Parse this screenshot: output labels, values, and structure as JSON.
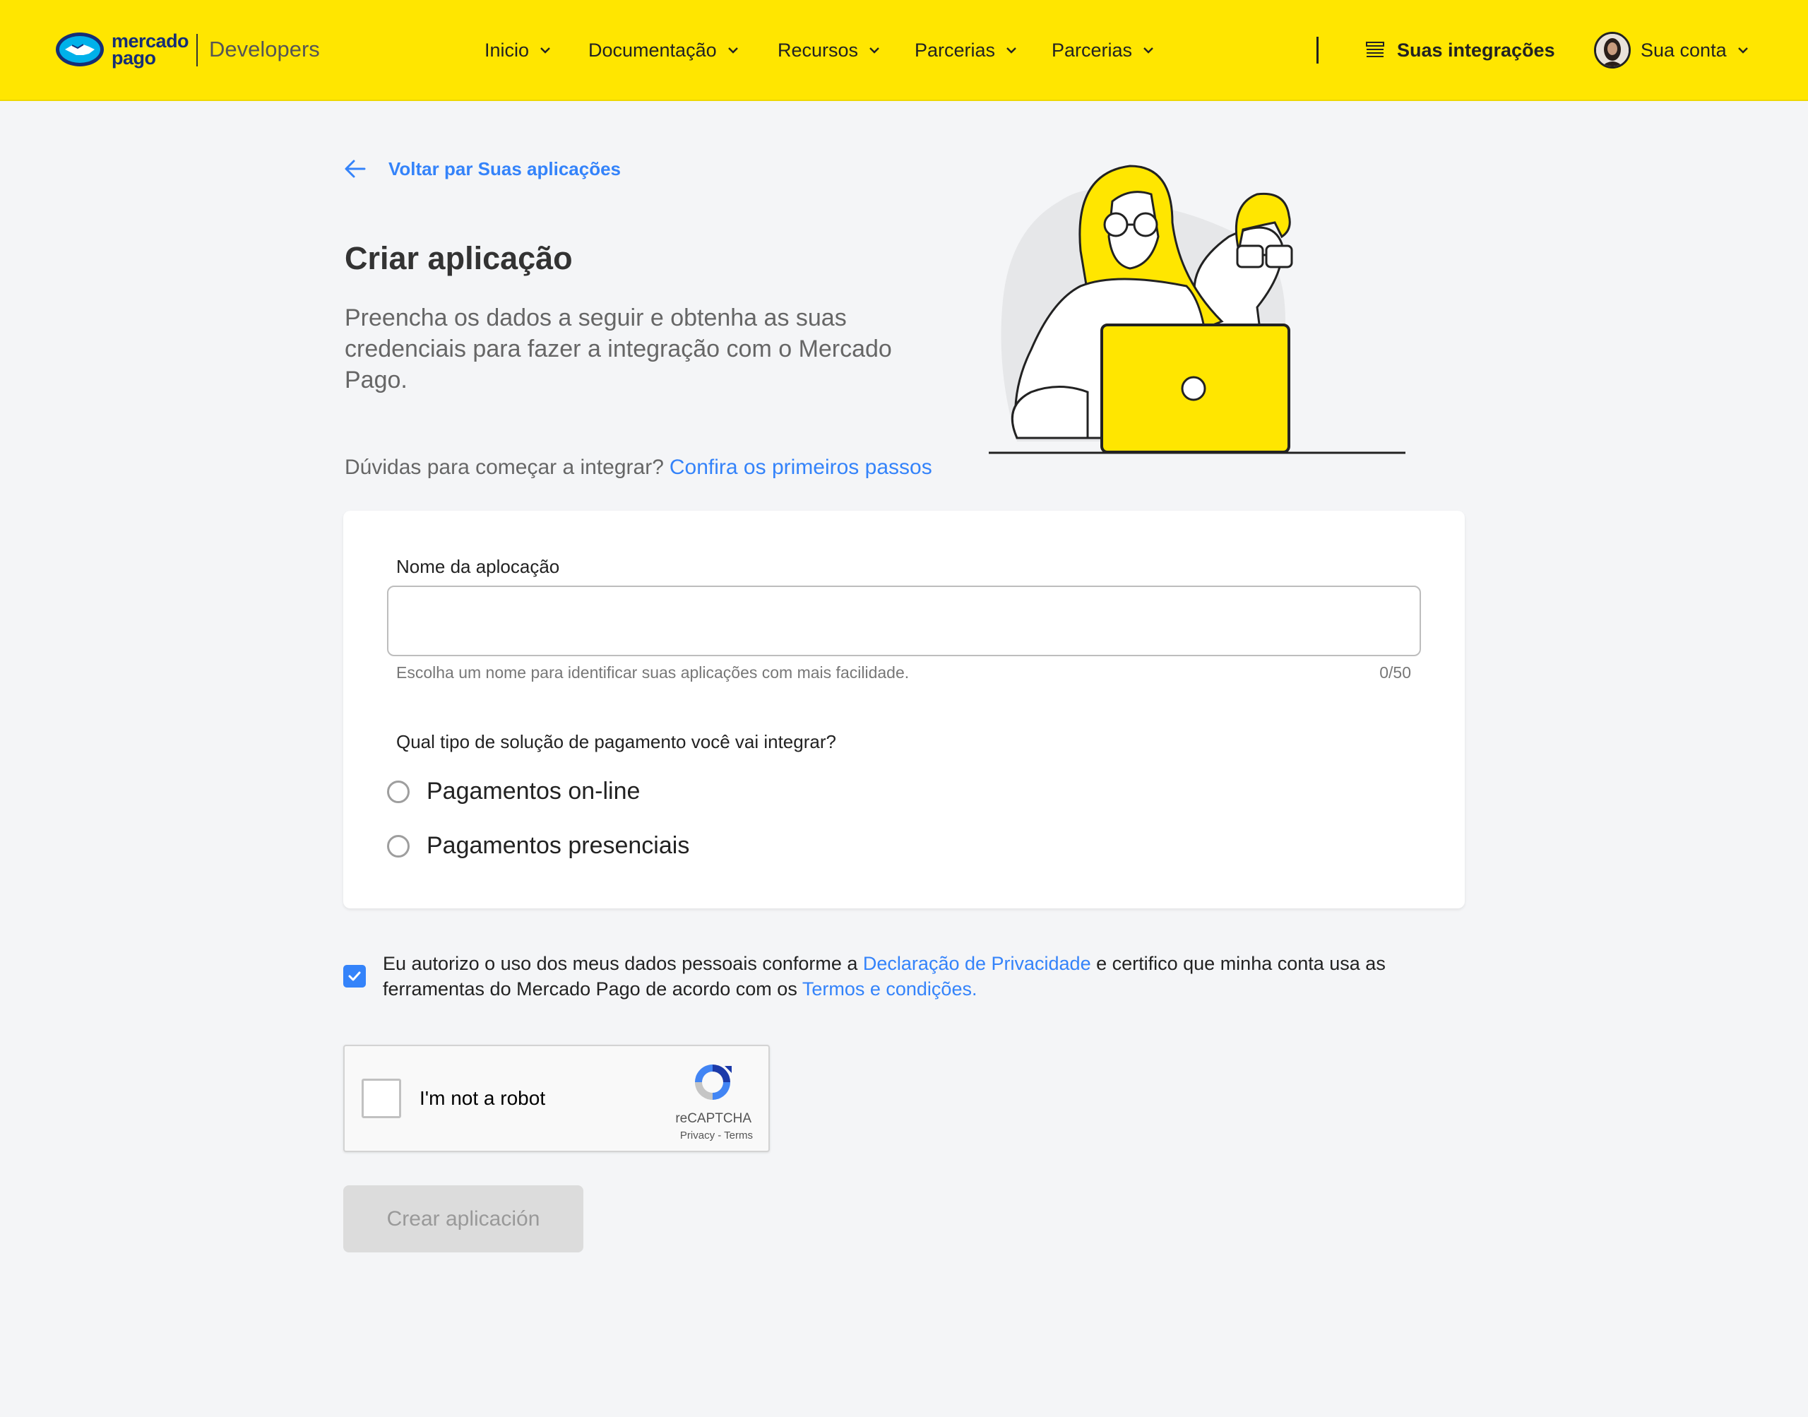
{
  "header": {
    "logo_line1": "mercado",
    "logo_line2": "pago",
    "developers": "Developers",
    "nav": [
      "Inicio",
      "Documentação",
      "Recursos",
      "Parcerias",
      "Parcerias"
    ],
    "integrations": "Suas integrações",
    "account": "Sua conta",
    "accent_color": "#ffe600"
  },
  "back_link": "Voltar par Suas aplicações",
  "page_title": "Criar aplicação",
  "subtitle": "Preencha os dados a seguir e obtenha as suas credenciais para fazer a integração com o Mercado Pago.",
  "doubts": {
    "text": "Dúvidas para começar a integrar?",
    "link": "Confira os primeiros passos"
  },
  "form": {
    "name_label": "Nome da aplocação",
    "name_value": "",
    "name_helper": "Escolha um nome para identificar suas aplicações com mais facilidade.",
    "name_counter": "0/50",
    "question": "Qual tipo de solução de pagamento você vai integrar?",
    "options": [
      "Pagamentos on-line",
      "Pagamentos presenciais"
    ]
  },
  "consent": {
    "part1": "Eu autorizo o uso dos meus dados pessoais conforme a ",
    "link1": "Declaração de Privacidade",
    "part2": " e certifico que minha conta usa as ferramentas do Mercado Pago de acordo com os ",
    "link2": "Termos e condições.",
    "checked": true
  },
  "captcha": {
    "label": "I'm not a robot",
    "brand": "reCAPTCHA",
    "links": "Privacy - Terms"
  },
  "submit_label": "Crear aplicación",
  "link_color": "#3483fa"
}
